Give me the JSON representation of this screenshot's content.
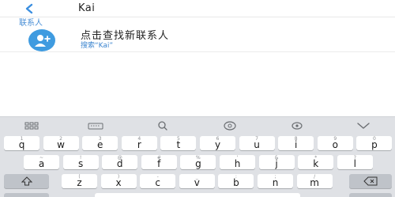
{
  "header": {
    "search_query": "Kai"
  },
  "section": {
    "label": "联系人"
  },
  "suggestion": {
    "title": "点击查找新联系人",
    "subtitle": "搜索“Kai”"
  },
  "keyboard": {
    "toolbar_icons": [
      "grid-menu-icon",
      "keyboard-icon",
      "search-icon",
      "emoji-icon",
      "voice-icon",
      "collapse-icon"
    ],
    "row1": [
      {
        "ch": "q",
        "num": "1"
      },
      {
        "ch": "w",
        "num": "2"
      },
      {
        "ch": "e",
        "num": "3"
      },
      {
        "ch": "r",
        "num": "4"
      },
      {
        "ch": "t",
        "num": "5"
      },
      {
        "ch": "y",
        "num": "6"
      },
      {
        "ch": "u",
        "num": "7"
      },
      {
        "ch": "i",
        "num": "8"
      },
      {
        "ch": "o",
        "num": "9"
      },
      {
        "ch": "p",
        "num": "0"
      }
    ],
    "row2": [
      {
        "ch": "a",
        "num": "~"
      },
      {
        "ch": "s",
        "num": "!"
      },
      {
        "ch": "d",
        "num": "@"
      },
      {
        "ch": "f",
        "num": "#"
      },
      {
        "ch": "g",
        "num": "%"
      },
      {
        "ch": "h",
        "num": "'"
      },
      {
        "ch": "j",
        "num": "&"
      },
      {
        "ch": "k",
        "num": "*"
      },
      {
        "ch": "l",
        "num": "?"
      }
    ],
    "row3": [
      {
        "ch": "z",
        "num": "("
      },
      {
        "ch": "x",
        "num": ")"
      },
      {
        "ch": "c",
        "num": "-"
      },
      {
        "ch": "v",
        "num": "_"
      },
      {
        "ch": "b",
        "num": ":"
      },
      {
        "ch": "n",
        "num": ";"
      },
      {
        "ch": "m",
        "num": "/"
      }
    ]
  },
  "colors": {
    "accent": "#3f9be0",
    "keyboard_bg": "#dfe1e5"
  }
}
